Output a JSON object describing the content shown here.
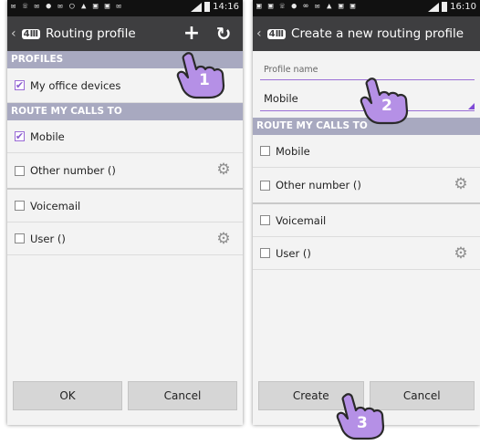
{
  "left": {
    "status": {
      "icons": "✉ ☏ ✉ ● ✉ ◯ ▲ ▣ ▣ ✉",
      "time": "14:16"
    },
    "header": {
      "back": "‹",
      "logo": "4Ⅲ",
      "title": "Routing profile",
      "add": "+",
      "refresh": "↻"
    },
    "profiles_header": "PROFILES",
    "profiles": [
      {
        "label": "My office devices",
        "checked": true
      }
    ],
    "route_header": "ROUTE MY CALLS TO",
    "routes": [
      {
        "label": "Mobile",
        "checked": true
      },
      {
        "label": "Other number ()",
        "checked": false
      },
      {
        "label": "Voicemail",
        "checked": false
      },
      {
        "label": "User ()",
        "checked": false
      }
    ],
    "buttons": {
      "ok": "OK",
      "cancel": "Cancel"
    }
  },
  "right": {
    "status": {
      "icons": "▣ ▣ ☏ ● ∞ ✉ ▲ ▣ ▣",
      "time": "16:10"
    },
    "header": {
      "back": "‹",
      "logo": "4Ⅲ",
      "title": "Create a new routing profile"
    },
    "profile_name_label": "Profile name",
    "profile_type_value": "Mobile",
    "route_header": "ROUTE MY CALLS TO",
    "routes": [
      {
        "label": "Mobile",
        "checked": false
      },
      {
        "label": "Other number ()",
        "checked": false
      },
      {
        "label": "Voicemail",
        "checked": false
      },
      {
        "label": "User ()",
        "checked": false
      }
    ],
    "buttons": {
      "create": "Create",
      "cancel": "Cancel"
    }
  },
  "callouts": [
    "1",
    "2",
    "3"
  ],
  "colors": {
    "actionbar": "#3e3e40",
    "section": "#a8a9c0",
    "accent": "#9b6fd6",
    "callout": "#b590e6"
  },
  "icons": {
    "check": "✔",
    "gear": "⚙"
  }
}
